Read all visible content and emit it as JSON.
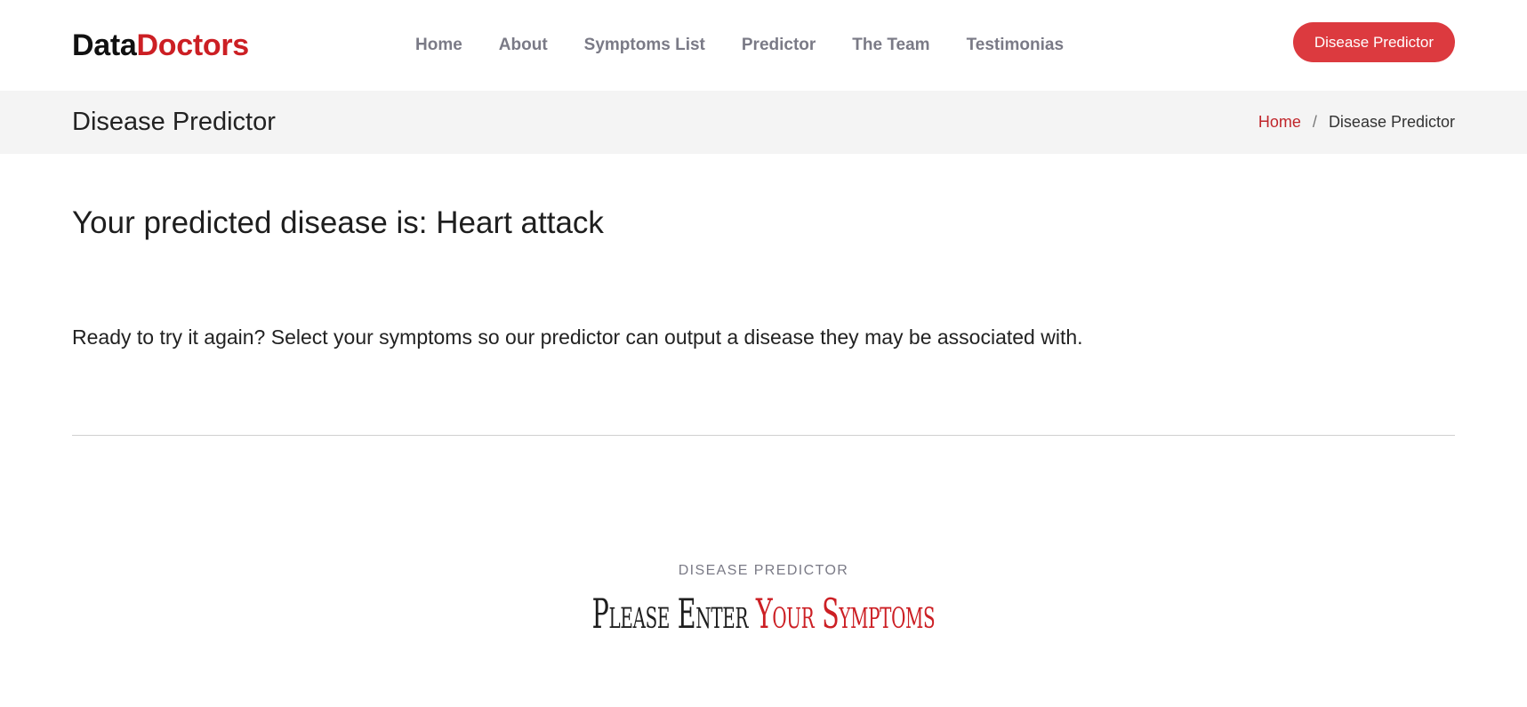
{
  "brand": {
    "part1": "Data",
    "part2": "Doctors"
  },
  "nav": {
    "items": [
      {
        "label": "Home"
      },
      {
        "label": "About"
      },
      {
        "label": "Symptoms List"
      },
      {
        "label": "Predictor"
      },
      {
        "label": "The Team"
      },
      {
        "label": "Testimonias"
      }
    ],
    "cta_label": "Disease Predictor"
  },
  "banner": {
    "title": "Disease Predictor",
    "breadcrumb": {
      "home": "Home",
      "separator": "/",
      "current": "Disease Predictor"
    }
  },
  "result": {
    "text": "Your predicted disease is: Heart attack"
  },
  "prompt": {
    "text": "Ready to try it again? Select your symptoms so our predictor can output a disease they may be associated with."
  },
  "predictor_section": {
    "kicker": "Disease Predictor",
    "heading_part1": "Please Enter ",
    "heading_part2": "Your Symptoms"
  },
  "colors": {
    "accent": "#cc1f24",
    "button": "#dc3a3f",
    "nav_text": "#7a7a86",
    "band_bg": "#f4f4f4"
  }
}
